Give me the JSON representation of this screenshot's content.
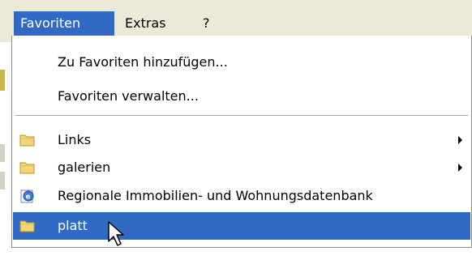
{
  "menubar": {
    "items": [
      {
        "label": "Favoriten",
        "active": true
      },
      {
        "label": "Extras",
        "active": false
      },
      {
        "label": "?",
        "active": false
      }
    ]
  },
  "menu": {
    "items": [
      {
        "label": "Zu Favoriten hinzufügen...",
        "icon": null,
        "submenu": false
      },
      {
        "label": "Favoriten verwalten...",
        "icon": null,
        "submenu": false
      },
      {
        "label": "Links",
        "icon": "folder-icon",
        "submenu": true
      },
      {
        "label": "galerien",
        "icon": "folder-icon",
        "submenu": true
      },
      {
        "label": "Regionale Immobilien- und Wohnungsdatenbank",
        "icon": "ie-link-icon",
        "submenu": false
      },
      {
        "label": "platt",
        "icon": "folder-icon",
        "submenu": false,
        "highlighted": true
      }
    ]
  },
  "colors": {
    "highlight": "#316ac5",
    "highlight_text": "#ffffff",
    "menu_bg": "#ffffff",
    "menubar_bg": "#ece9d8",
    "folder": "#f5d57a"
  }
}
